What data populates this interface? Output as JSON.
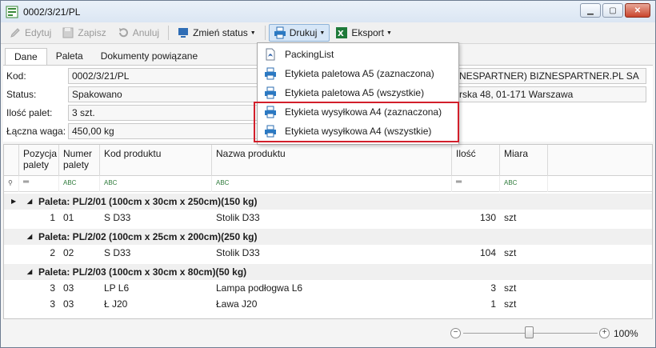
{
  "window": {
    "title": "0002/3/21/PL",
    "buttons": [
      "minimize",
      "maximize",
      "close"
    ]
  },
  "toolbar": {
    "edit_label": "Edytuj",
    "save_label": "Zapisz",
    "cancel_label": "Anuluj",
    "change_status_label": "Zmień status",
    "print_label": "Drukuj",
    "export_label": "Eksport"
  },
  "print_menu": {
    "items": [
      {
        "label": "PackingList",
        "icon": "pdf-icon"
      },
      {
        "label": "Etykieta paletowa A5 (zaznaczona)",
        "icon": "printer-icon"
      },
      {
        "label": "Etykieta paletowa A5 (wszystkie)",
        "icon": "printer-icon"
      },
      {
        "label": "Etykieta wysyłkowa A4 (zaznaczona)",
        "icon": "printer-icon"
      },
      {
        "label": "Etykieta wysyłkowa A4 (wszystkie)",
        "icon": "printer-icon"
      }
    ]
  },
  "tabs": [
    "Dane",
    "Paleta",
    "Dokumenty powiązane"
  ],
  "form": {
    "code_label": "Kod:",
    "code_value": "0002/3/21/PL",
    "status_label": "Status:",
    "status_value": "Spakowano",
    "pallets_label": "Ilość palet:",
    "pallets_value": "3 szt.",
    "weight_label": "Łączna waga:",
    "weight_value": "450,00 kg",
    "partner_value": "NESPARTNER) BIZNESPARTNER.PL SA",
    "address_value": "rska 48, 01-171 Warszawa"
  },
  "grid": {
    "columns": [
      "Pozycja palety",
      "Numer palety",
      "Kod produktu",
      "Nazwa produktu",
      "Ilość",
      "Miara"
    ],
    "groups": [
      {
        "label": "Paleta: PL/2/01 (100cm x 30cm x 250cm)(150 kg)",
        "rows": [
          {
            "pos": "1",
            "num": "01",
            "code": "S D33",
            "name": "Stolik D33",
            "qty": "130",
            "unit": "szt"
          }
        ]
      },
      {
        "label": "Paleta: PL/2/02 (100cm x 25cm x 200cm)(250 kg)",
        "rows": [
          {
            "pos": "2",
            "num": "02",
            "code": "S D33",
            "name": "Stolik D33",
            "qty": "104",
            "unit": "szt"
          }
        ]
      },
      {
        "label": "Paleta: PL/2/03 (100cm x 30cm x 80cm)(50 kg)",
        "rows": [
          {
            "pos": "3",
            "num": "03",
            "code": "LP L6",
            "name": "Lampa podłogwa L6",
            "qty": "3",
            "unit": "szt"
          },
          {
            "pos": "3",
            "num": "03",
            "code": "Ł J20",
            "name": "Ława J20",
            "qty": "1",
            "unit": "szt"
          }
        ]
      }
    ]
  },
  "zoom": {
    "label": "100%",
    "level_percent": 100
  }
}
